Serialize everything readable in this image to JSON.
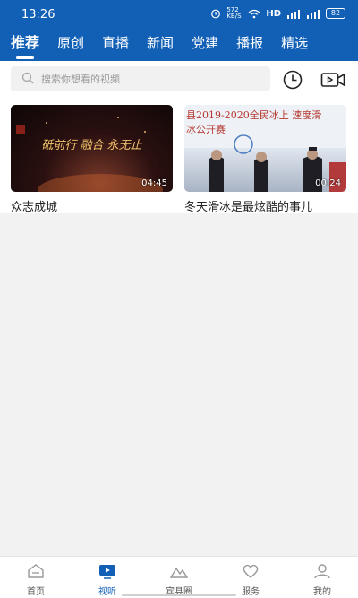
{
  "status_bar": {
    "time": "13:26",
    "speed": "572 KB/S",
    "hd": "HD",
    "battery": "82"
  },
  "tabs": [
    {
      "label": "推荐",
      "active": true
    },
    {
      "label": "原创",
      "active": false
    },
    {
      "label": "直播",
      "active": false
    },
    {
      "label": "新闻",
      "active": false
    },
    {
      "label": "党建",
      "active": false
    },
    {
      "label": "播报",
      "active": false
    },
    {
      "label": "精选",
      "active": false
    }
  ],
  "search": {
    "placeholder": "搜索你想看的视频"
  },
  "videos": [
    {
      "title": "众志成城",
      "duration": "04:45",
      "thumb_text": "砥前行 融合 永无止"
    },
    {
      "title": "冬天滑冰是最炫酷的事儿",
      "duration": "00:24",
      "thumb_text": "县2019-2020全民冰上 速度滑冰公开赛"
    }
  ],
  "bottom_nav": [
    {
      "label": "首页",
      "icon": "home-icon",
      "active": false
    },
    {
      "label": "视听",
      "icon": "tv-icon",
      "active": true
    },
    {
      "label": "宾县圈",
      "icon": "mountain-icon",
      "active": false
    },
    {
      "label": "服务",
      "icon": "heart-icon",
      "active": false
    },
    {
      "label": "我的",
      "icon": "user-icon",
      "active": false
    }
  ],
  "colors": {
    "brand": "#1160b6",
    "background": "#f2f2f2"
  }
}
